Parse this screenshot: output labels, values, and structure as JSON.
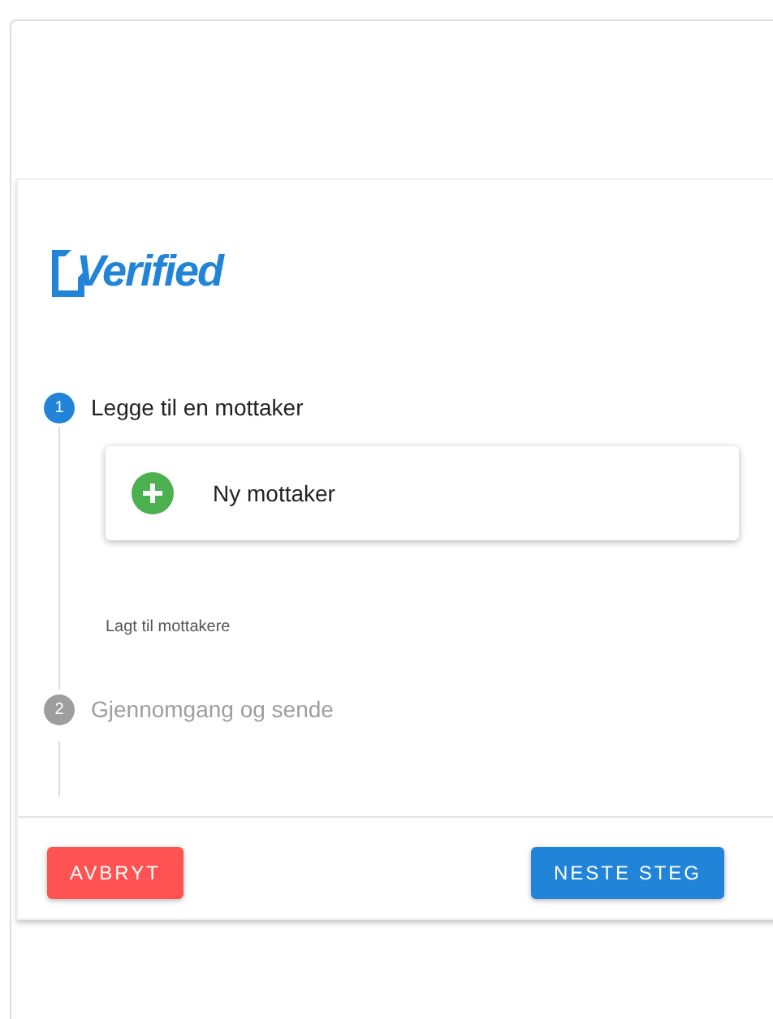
{
  "logo": {
    "text": "Verified"
  },
  "steps": [
    {
      "number": "1",
      "label": "Legge til en mottaker",
      "active": true,
      "add_button": {
        "label": "Ny mottaker"
      },
      "note": "Lagt til mottakere"
    },
    {
      "number": "2",
      "label": "Gjennomgang og sende",
      "active": false
    }
  ],
  "buttons": {
    "cancel": "AVBRYT",
    "next": "NESTE STEG"
  }
}
